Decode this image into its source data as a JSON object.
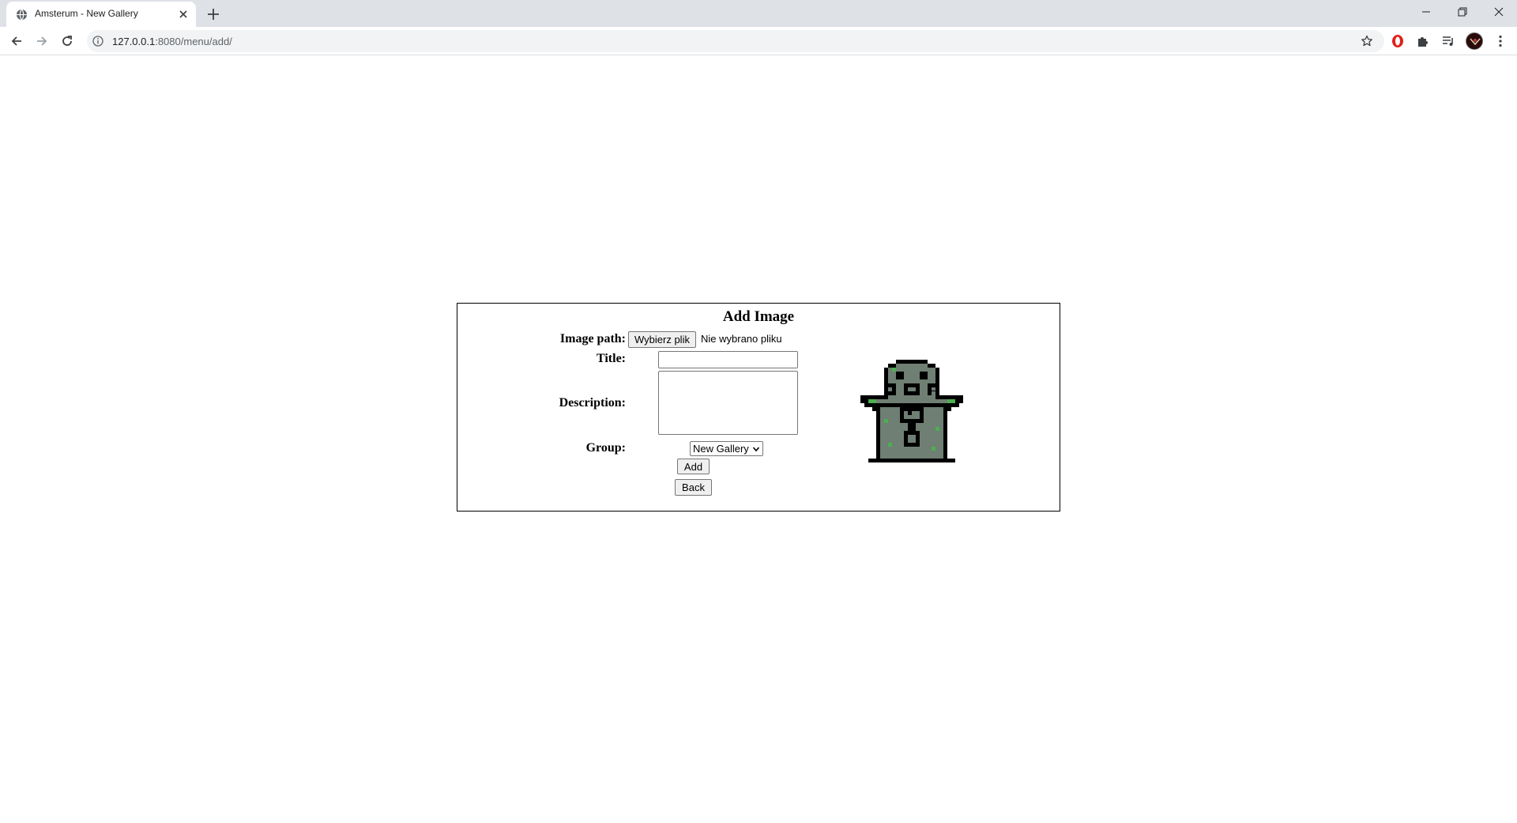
{
  "browser": {
    "tab_title": "Amsterum - New Gallery",
    "url_host": "127.0.0.1",
    "url_path": ":8080/menu/add/"
  },
  "form": {
    "title": "Add Image",
    "image_path_label": "Image path:",
    "file_button_label": "Wybierz plik",
    "file_status": "Nie wybrano pliku",
    "title_label": "Title:",
    "title_value": "",
    "description_label": "Description:",
    "description_value": "",
    "group_label": "Group:",
    "group_selected": "New Gallery",
    "add_label": "Add",
    "back_label": "Back"
  },
  "icons": {
    "favicon": "globe-icon",
    "tab_close": "close-icon",
    "new_tab": "plus-icon",
    "back": "arrow-left-icon",
    "forward": "arrow-right-icon",
    "reload": "reload-icon",
    "site_info": "info-icon",
    "bookmark": "star-icon",
    "extensions": [
      "opera-icon",
      "puzzle-icon",
      "media-queue-icon"
    ],
    "menu": "more-vert-icon"
  },
  "colors": {
    "tabstrip": "#dee1e6",
    "omnibox": "#f1f3f4",
    "form_border": "#000000",
    "mascot_body": "#6f7f73",
    "mascot_accent": "#4caf50"
  }
}
